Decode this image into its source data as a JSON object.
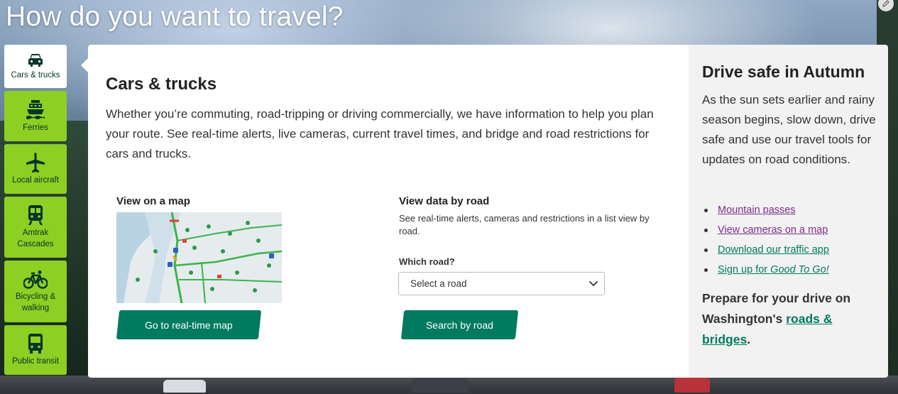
{
  "page": {
    "title": "How do you want to travel?"
  },
  "modes": [
    {
      "label": "Cars & trucks",
      "icon": "car-icon",
      "active": true
    },
    {
      "label": "Ferries",
      "icon": "ferry-icon",
      "active": false
    },
    {
      "label": "Local aircraft",
      "icon": "airplane-icon",
      "active": false
    },
    {
      "label": "Amtrak Cascades",
      "icon": "train-icon",
      "active": false
    },
    {
      "label": "Bicycling & walking",
      "icon": "bicycle-icon",
      "active": false
    },
    {
      "label": "Public transit",
      "icon": "bus-icon",
      "active": false
    }
  ],
  "main": {
    "title": "Cars & trucks",
    "description": "Whether you’re commuting, road-tripping or driving commercially, we have information to help you plan your route. See real-time alerts, live cameras, current travel times, and bridge and road restrictions for cars and trucks.",
    "map": {
      "heading": "View on a map",
      "button": "Go to real-time map"
    },
    "road": {
      "heading": "View data by road",
      "description": "See real-time alerts, cameras and restrictions in a list view by road.",
      "select_label": "Which road?",
      "select_value": "Select a road",
      "button": "Search by road"
    }
  },
  "side": {
    "title": "Drive safe in Autumn",
    "description": "As the sun sets earlier and rainy season begins, slow down, drive safe and use our travel tools for updates on road conditions.",
    "links": [
      {
        "text": "Mountain passes"
      },
      {
        "text": "View cameras on a map"
      },
      {
        "text": "Download our traffic app"
      },
      {
        "text": "Sign up for ",
        "emphasis": "Good To Go!"
      }
    ],
    "prepare_text": "Prepare for your drive on Washington's ",
    "prepare_link": "roads & bridges",
    "prepare_end": "."
  },
  "colors": {
    "brand_green": "#007b5f",
    "tab_green": "#8dcf22",
    "visited_link": "#7b2d8b"
  }
}
